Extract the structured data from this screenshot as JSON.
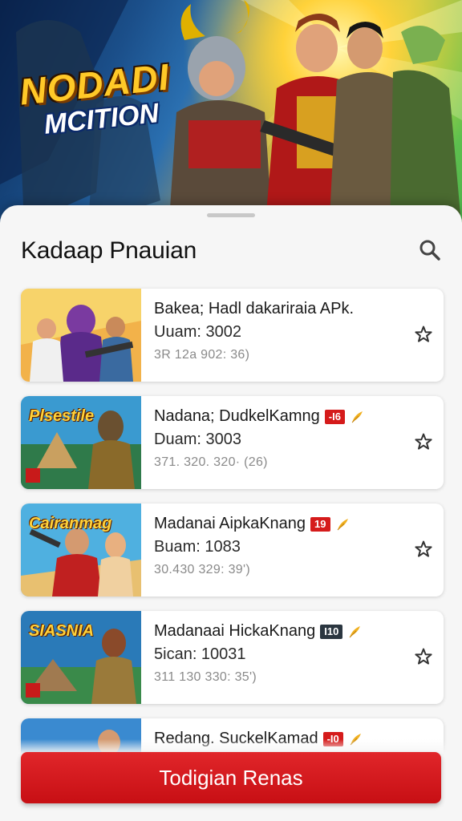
{
  "hero": {
    "logo_line1": "NODADI",
    "logo_line2": "MCITION"
  },
  "sheet": {
    "title": "Kadaap Pnauian",
    "search_icon": "search-icon"
  },
  "apps": [
    {
      "name": "Bakea; Hadl dakariraia APk.",
      "meta": "Uuam: 3002",
      "sub": "3R 12a 902: 36)",
      "badge": "",
      "thumb_text": "",
      "star_icon": "star-outline-icon"
    },
    {
      "name": "Nadana; DudkelKamng",
      "meta": "Duam: 3003",
      "sub": "371. 320. 320· (26)",
      "badge": "-I6",
      "thumb_text": "Plsestile",
      "star_icon": "star-outline-icon"
    },
    {
      "name": "Madanai AipkaKnang",
      "meta": "Buam: 1083",
      "sub": "30.430 329: 39')",
      "badge": "19",
      "thumb_text": "Cairanmag",
      "star_icon": "star-outline-icon"
    },
    {
      "name": "Madanaai HickaKnang",
      "meta": "5ican: 10031",
      "sub": "311 130 330: 35')",
      "badge": "I10",
      "thumb_text": "SIASNIA",
      "star_icon": "star-outline-icon"
    },
    {
      "name": "Redang. SuckelKamad",
      "meta": "",
      "sub": "",
      "badge": "-I0",
      "thumb_text": "",
      "star_icon": "star-outline-icon"
    }
  ],
  "cta": {
    "label": "Todigian Renas"
  },
  "colors": {
    "accent": "#d51b1b",
    "badge_dark": "#2b3640",
    "feather": "#f0b020"
  }
}
